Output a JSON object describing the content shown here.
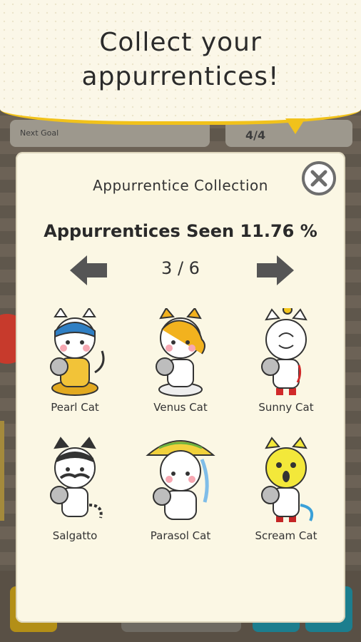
{
  "banner": {
    "title": "Collect your appurrentices!"
  },
  "background": {
    "left_bar_label": "Next Goal",
    "right_bar_value": "4/4"
  },
  "modal": {
    "title": "Appurrentice Collection",
    "seen_label": "Appurrentices Seen 11.76 %",
    "page_indicator": "3 / 6"
  },
  "cats": [
    {
      "name": "Pearl Cat"
    },
    {
      "name": "Venus Cat"
    },
    {
      "name": "Sunny Cat"
    },
    {
      "name": "Salgatto"
    },
    {
      "name": "Parasol Cat"
    },
    {
      "name": "Scream Cat"
    }
  ],
  "colors": {
    "accent_yellow": "#f1c21b",
    "panel_bg": "#fbf7e4",
    "arrow_gray": "#555555"
  }
}
